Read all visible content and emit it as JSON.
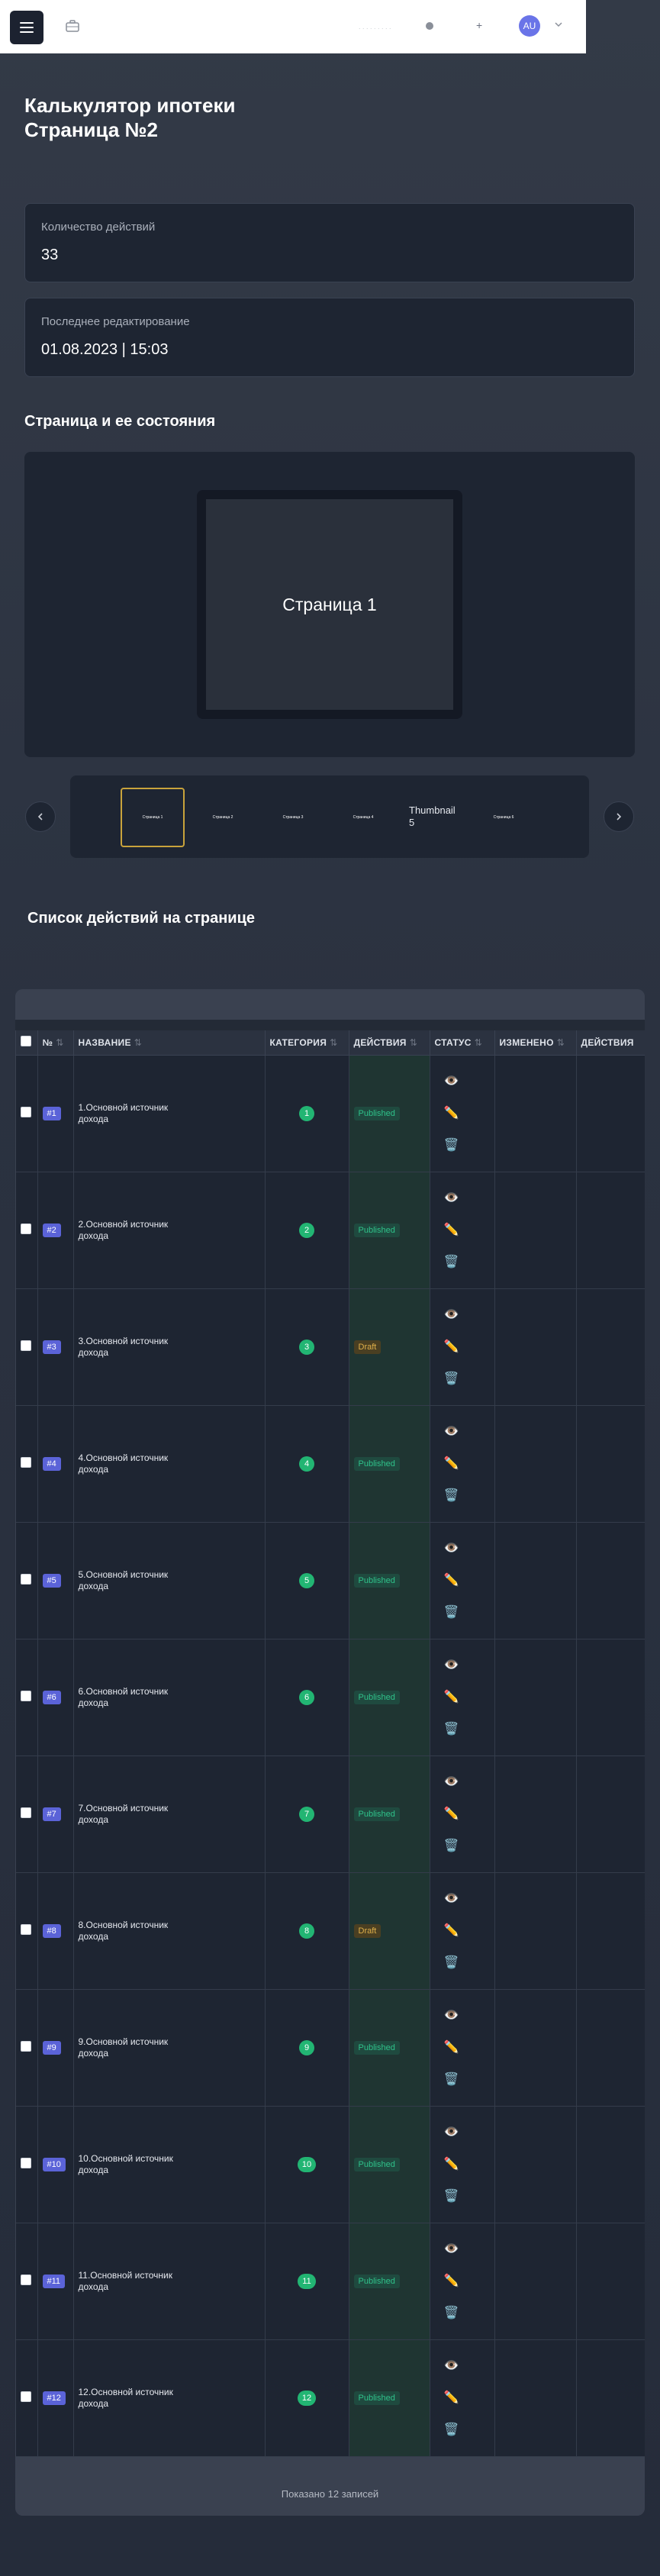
{
  "topbar": {
    "user_initials": "AU",
    "menu_icon": "hamburger-icon",
    "briefcase_icon": "briefcase-icon"
  },
  "page": {
    "title_line1": "Калькулятор ипотеки",
    "title_line2": "Страница №2"
  },
  "stats": [
    {
      "label": "Количество действий",
      "value": "33"
    },
    {
      "label": "Последнее редактирование",
      "value": "01.08.2023 | 15:03"
    }
  ],
  "pages_section": {
    "title": "Страница и ее состояния",
    "preview_label": "Страница 1",
    "thumbnails": [
      {
        "label": "Страница 1",
        "active": true
      },
      {
        "label": "Страница 2",
        "active": false
      },
      {
        "label": "Страница 3",
        "active": false
      },
      {
        "label": "Страница 4",
        "active": false
      },
      {
        "label": "Thumbnail 5",
        "active": false,
        "broken_image": true
      },
      {
        "label": "Страница 6",
        "active": false
      }
    ]
  },
  "actions_section": {
    "title": "Список действий на странице"
  },
  "table": {
    "columns": [
      "№",
      "Название",
      "Категория",
      "Действия",
      "Статус",
      "Изменено",
      "Действия"
    ],
    "rows": [
      {
        "num": "#1",
        "name": "1.Основной источник дохода",
        "category": "1",
        "status": "Published"
      },
      {
        "num": "#2",
        "name": "2.Основной источник дохода",
        "category": "2",
        "status": "Published"
      },
      {
        "num": "#3",
        "name": "3.Основной источник дохода",
        "category": "3",
        "status": "Draft"
      },
      {
        "num": "#4",
        "name": "4.Основной источник дохода",
        "category": "4",
        "status": "Published"
      },
      {
        "num": "#5",
        "name": "5.Основной источник дохода",
        "category": "5",
        "status": "Published"
      },
      {
        "num": "#6",
        "name": "6.Основной источник дохода",
        "category": "6",
        "status": "Published"
      },
      {
        "num": "#7",
        "name": "7.Основной источник дохода",
        "category": "7",
        "status": "Published"
      },
      {
        "num": "#8",
        "name": "8.Основной источник дохода",
        "category": "8",
        "status": "Draft"
      },
      {
        "num": "#9",
        "name": "9.Основной источник дохода",
        "category": "9",
        "status": "Published"
      },
      {
        "num": "#10",
        "name": "10.Основной источник дохода",
        "category": "10",
        "status": "Published"
      },
      {
        "num": "#11",
        "name": "11.Основной источник дохода",
        "category": "11",
        "status": "Published"
      },
      {
        "num": "#12",
        "name": "12.Основной источник дохода",
        "category": "12",
        "status": "Published"
      }
    ],
    "row_actions": [
      "👁️",
      "✏️",
      "🗑️"
    ],
    "footer": "Показано 12 записей"
  },
  "colors": {
    "accent": "#5b63d8",
    "category_badge": "#22b573",
    "published": "#2fc28a",
    "draft": "#e0b04a",
    "active_thumb_border": "#c9a33b"
  }
}
